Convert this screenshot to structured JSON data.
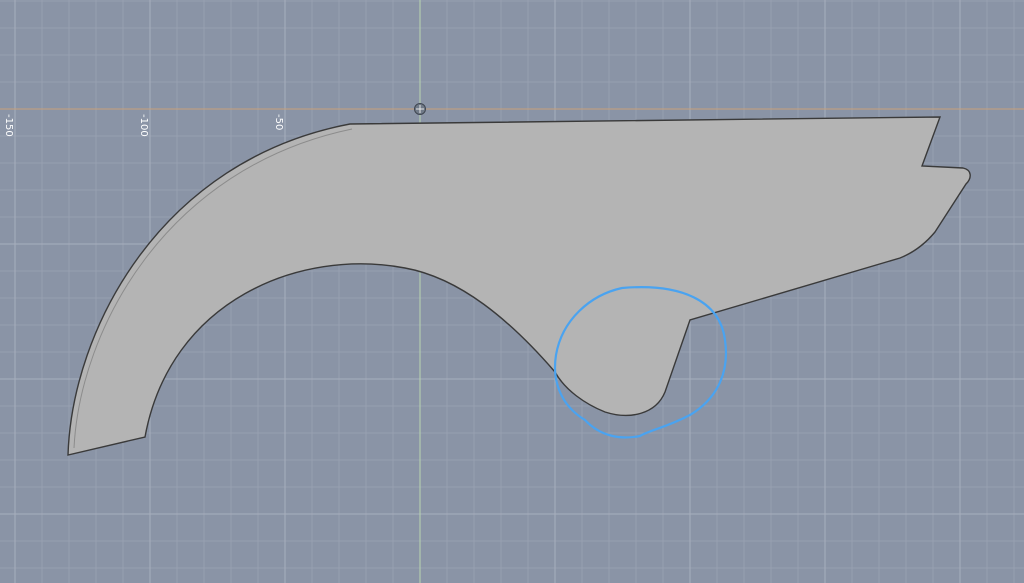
{
  "canvas": {
    "background_color": "#8a94a6",
    "grid_minor_color": "#9aa3b3",
    "grid_major_color": "#a7afbd",
    "axis_x_color": "#c8a07a",
    "axis_y_color": "#b9d6b0"
  },
  "ruler": {
    "labels": [
      "-150",
      "-100",
      "-50"
    ]
  },
  "part": {
    "fill_color": "#b4b4b4",
    "edge_color": "#3a3a3a"
  },
  "markup": {
    "stroke_color": "#4aa3f0"
  },
  "icons": {
    "origin": "origin-marker-icon"
  }
}
